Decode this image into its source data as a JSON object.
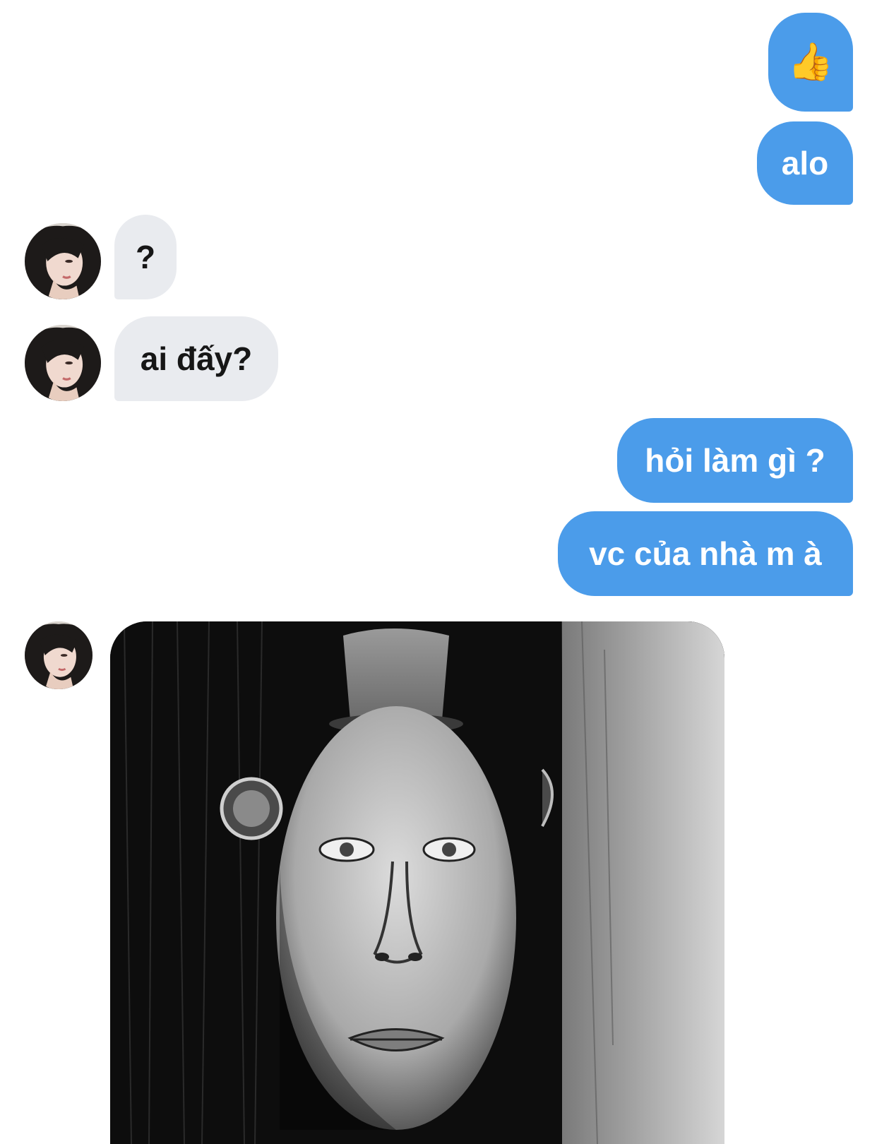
{
  "messages": [
    {
      "id": "m1",
      "direction": "outgoing",
      "text": "👍"
    },
    {
      "id": "m2",
      "direction": "outgoing",
      "text": "alo"
    },
    {
      "id": "m3",
      "direction": "incoming",
      "text": "?"
    },
    {
      "id": "m4",
      "direction": "incoming",
      "text": "ai đấy?"
    },
    {
      "id": "m5",
      "direction": "outgoing",
      "text": "hỏi làm gì ?"
    },
    {
      "id": "m6",
      "direction": "outgoing",
      "text": "vc của nhà m à"
    },
    {
      "id": "m7",
      "direction": "incoming",
      "type": "image",
      "image_icon": "pencil-drawing-face-image"
    }
  ],
  "colors": {
    "outgoing_bubble": "#4b9cea",
    "incoming_bubble": "#e9ebef",
    "outgoing_text": "#ffffff",
    "incoming_text": "#161616",
    "background": "#ffffff"
  },
  "icons": {
    "avatar": "contact-avatar-icon",
    "thumbs_up": "thumbs-up-emoji"
  }
}
